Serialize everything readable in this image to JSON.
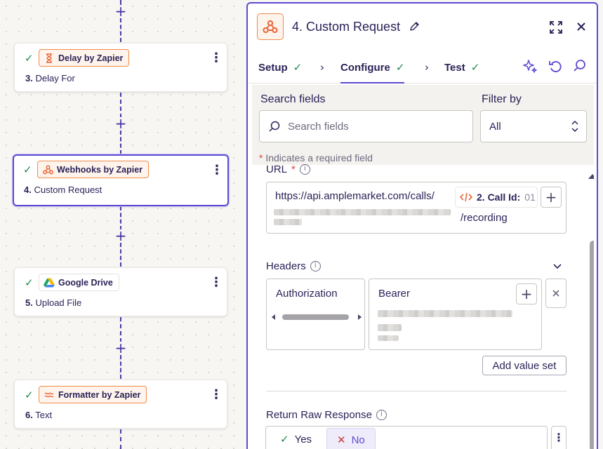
{
  "canvas": {
    "steps": [
      {
        "app": "Delay by Zapier",
        "number": "3.",
        "title": "Delay For",
        "icon": "hourglass-icon",
        "selected": false
      },
      {
        "app": "Webhooks by Zapier",
        "number": "4.",
        "title": "Custom Request",
        "icon": "webhook-icon",
        "selected": true
      },
      {
        "app": "Google Drive",
        "number": "5.",
        "title": "Upload File",
        "icon": "google-drive-icon",
        "selected": false
      },
      {
        "app": "Formatter by Zapier",
        "number": "6.",
        "title": "Text",
        "icon": "formatter-icon",
        "selected": false
      }
    ],
    "add_step_symbol": "+",
    "step_menu_symbol": "⋮",
    "step_check_symbol": "✓"
  },
  "panel": {
    "title": "4. Custom Request",
    "tabs": [
      {
        "label": "Setup",
        "done": true
      },
      {
        "label": "Configure",
        "done": true,
        "active": true
      },
      {
        "label": "Test",
        "done": true
      }
    ],
    "tab_separator": "›",
    "tools": [
      "ai-sparkle-icon",
      "undo-icon",
      "search-icon"
    ]
  },
  "filters": {
    "search_label": "Search fields",
    "search_placeholder": "Search fields",
    "filter_label": "Filter by",
    "filter_value": "All",
    "required_star": "*",
    "required_note": "Indicates a required field"
  },
  "url_field": {
    "label": "URL",
    "required_star": "*",
    "value_prefix": "https://api.amplemarket.com/calls/",
    "pill_label": "2. Call Id:",
    "pill_value": "01",
    "value_suffix": "/recording"
  },
  "headers_field": {
    "label": "Headers",
    "key": "Authorization",
    "value": "Bearer",
    "add_value_set": "Add value set"
  },
  "raw_response": {
    "label": "Return Raw Response",
    "yes": "Yes",
    "no": "No",
    "selected": "No"
  },
  "colors": {
    "accent": "#5b4bd0",
    "brand_orange": "#f08b4c",
    "success": "#1f8a4c",
    "required": "#e0453b"
  }
}
